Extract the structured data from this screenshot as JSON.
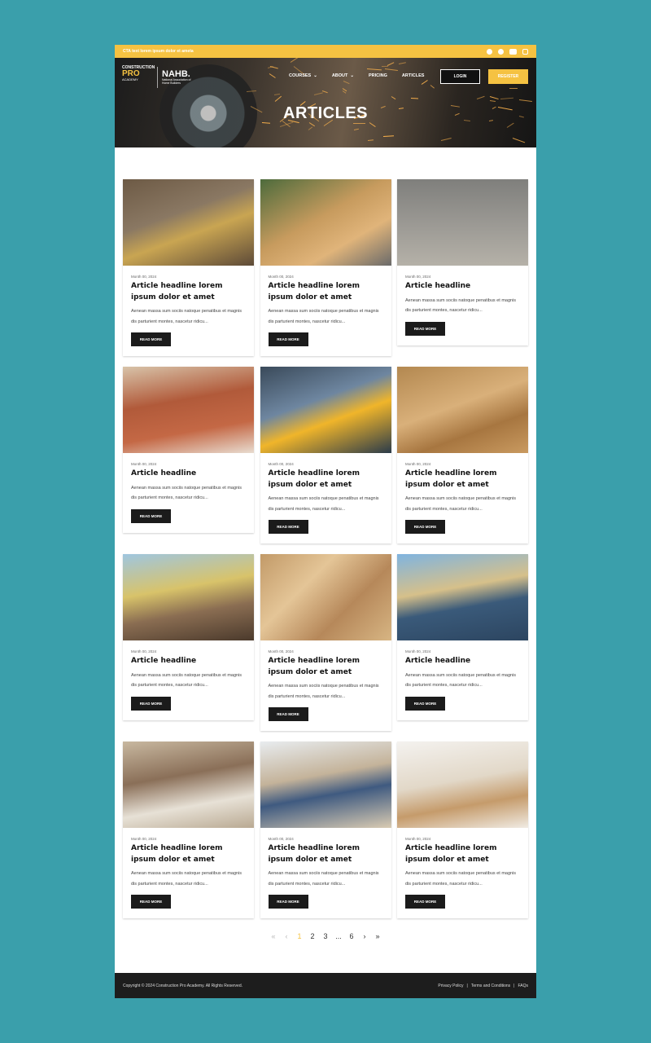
{
  "topbar": {
    "cta": "CTA text lorem ipsum dolor et ameta",
    "social_icons": [
      "facebook-icon",
      "pinterest-icon",
      "youtube-icon",
      "instagram-icon"
    ]
  },
  "header": {
    "logo_primary": {
      "line1": "CONSTRUCTION",
      "line2": "PRO",
      "line3": "ACADEMY"
    },
    "logo_secondary": {
      "line1": "NAHB.",
      "line2": "National Association of Home Builders"
    },
    "nav": [
      "COURSES",
      "ABOUT",
      "PRICING",
      "ARTICLES"
    ],
    "login_label": "LOGIN",
    "register_label": "REGISTER"
  },
  "hero": {
    "title": "ARTICLES"
  },
  "articles": [
    {
      "date": "Month 00, 2024",
      "headline": "Article headline lorem ipsum dolor et amet",
      "excerpt": "Aenean massa sum sociis natoque penatibus et magnis dis parturient montes, nascetur ridicu...",
      "button": "READ MORE"
    },
    {
      "date": "Month 00, 2024",
      "headline": "Article headline lorem ipsum dolor et amet",
      "excerpt": "Aenean massa sum sociis natoque penatibus et magnis dis parturient montes, nascetur ridicu...",
      "button": "READ MORE"
    },
    {
      "date": "Month 00, 2024",
      "headline": "Article headline",
      "excerpt": "Aenean massa sum sociis natoque penatibus et magnis dis parturient montes, nascetur ridicu...",
      "button": "READ MORE"
    },
    {
      "date": "Month 00, 2024",
      "headline": "Article headline",
      "excerpt": "Aenean massa sum sociis natoque penatibus et magnis dis parturient montes, nascetur ridicu...",
      "button": "READ MORE"
    },
    {
      "date": "Month 00, 2024",
      "headline": "Article headline lorem ipsum dolor et amet",
      "excerpt": "Aenean massa sum sociis natoque penatibus et magnis dis parturient montes, nascetur ridicu...",
      "button": "READ MORE"
    },
    {
      "date": "Month 00, 2024",
      "headline": "Article headline lorem ipsum dolor et amet",
      "excerpt": "Aenean massa sum sociis natoque penatibus et magnis dis parturient montes, nascetur ridicu...",
      "button": "READ MORE"
    },
    {
      "date": "Month 00, 2024",
      "headline": "Article headline",
      "excerpt": "Aenean massa sum sociis natoque penatibus et magnis dis parturient montes, nascetur ridicu...",
      "button": "READ MORE"
    },
    {
      "date": "Month 00, 2024",
      "headline": "Article headline lorem ipsum dolor et amet",
      "excerpt": "Aenean massa sum sociis natoque penatibus et magnis dis parturient montes, nascetur ridicu...",
      "button": "READ MORE"
    },
    {
      "date": "Month 00, 2024",
      "headline": "Article headline",
      "excerpt": "Aenean massa sum sociis natoque penatibus et magnis dis parturient montes, nascetur ridicu...",
      "button": "READ MORE"
    },
    {
      "date": "Month 00, 2024",
      "headline": "Article headline lorem ipsum dolor et amet",
      "excerpt": "Aenean massa sum sociis natoque penatibus et magnis dis parturient montes, nascetur ridicu...",
      "button": "READ MORE"
    },
    {
      "date": "Month 00, 2024",
      "headline": "Article headline lorem ipsum dolor et amet",
      "excerpt": "Aenean massa sum sociis natoque penatibus et magnis dis parturient montes, nascetur ridicu...",
      "button": "READ MORE"
    },
    {
      "date": "Month 00, 2024",
      "headline": "Article headline lorem ipsum dolor et amet",
      "excerpt": "Aenean massa sum sociis natoque penatibus et magnis dis parturient montes, nascetur ridicu...",
      "button": "READ MORE"
    }
  ],
  "pagination": {
    "first": "«",
    "prev": "‹",
    "pages": [
      "1",
      "2",
      "3",
      "...",
      "6"
    ],
    "current": "1",
    "next": "›",
    "last": "»"
  },
  "footer": {
    "copyright": "Copyright © 2024 Construction Pro Academy. All Rights Reserved.",
    "links": [
      "Privacy Policy",
      "|",
      "Terms and Conditions",
      "|",
      "FAQs"
    ]
  },
  "colors": {
    "background": "#3a9fab",
    "accent": "#f5c242",
    "dark": "#1b1b1b"
  }
}
